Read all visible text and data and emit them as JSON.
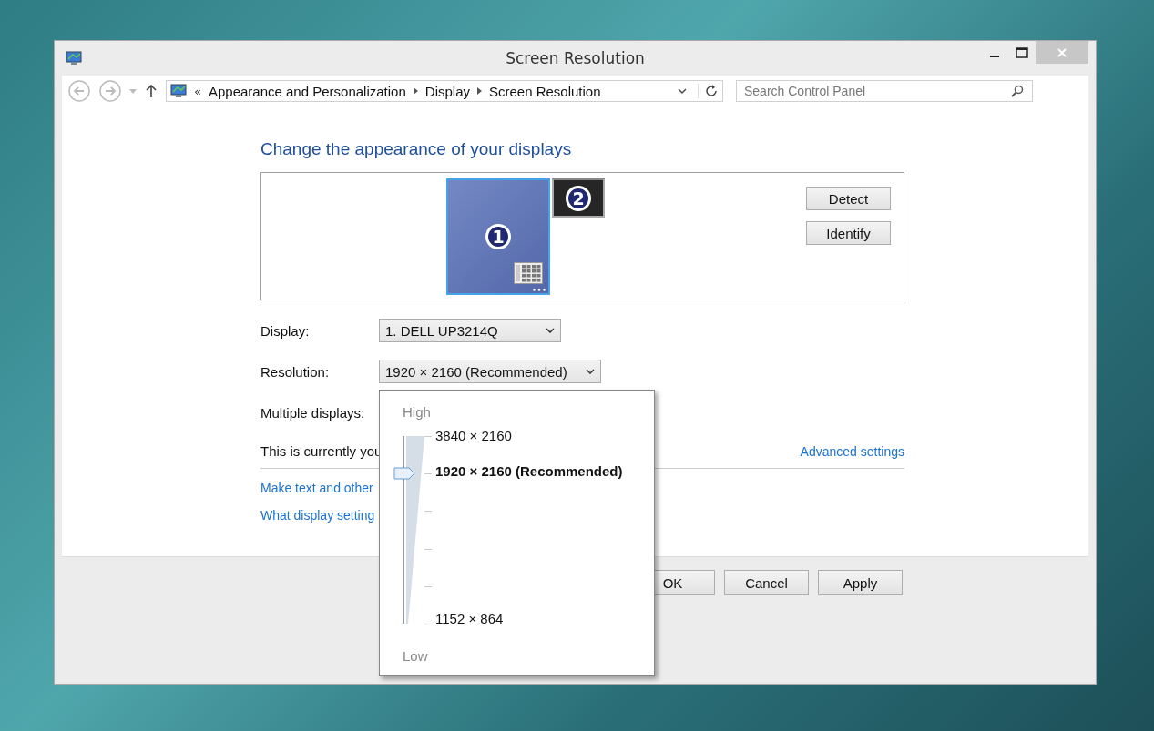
{
  "window": {
    "title": "Screen Resolution"
  },
  "address_bar": {
    "chevron": "«",
    "path": [
      "Appearance and Personalization",
      "Display",
      "Screen Resolution"
    ]
  },
  "search": {
    "placeholder": "Search Control Panel"
  },
  "heading": "Change the appearance of your displays",
  "monitors": [
    {
      "label": "1",
      "selected": true
    },
    {
      "label": "2",
      "selected": false
    }
  ],
  "monitor_buttons": [
    "Detect",
    "Identify"
  ],
  "settings": [
    {
      "label": "Display:",
      "value": "1. DELL UP3214Q"
    },
    {
      "label": "Resolution:",
      "value": "1920 × 2160 (Recommended)"
    },
    {
      "label": "Multiple displays:"
    }
  ],
  "status_text": "This is currently you",
  "advanced_link": "Advanced settings",
  "links": [
    "Make text and other",
    "What display setting"
  ],
  "buttons": [
    "OK",
    "Cancel",
    "Apply"
  ],
  "resolution_popup": {
    "high_label": "High",
    "low_label": "Low",
    "slider": {
      "level": 0.8
    },
    "options": [
      {
        "label": "3840 × 2160",
        "selected": false
      },
      {
        "label": "1920 × 2160 (Recommended)",
        "selected": true
      },
      {
        "label": "1152 × 864",
        "selected": false
      }
    ]
  }
}
